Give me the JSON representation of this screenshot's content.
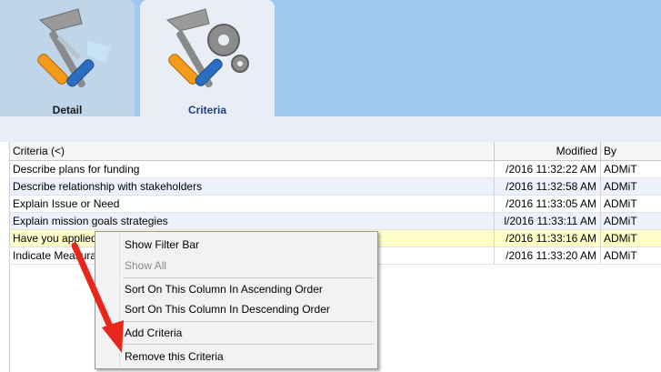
{
  "tabs": [
    {
      "label": "Detail",
      "icon": "hammer-screwdriver-icon",
      "active": false
    },
    {
      "label": "Criteria",
      "icon": "tools-gears-icon",
      "active": true
    }
  ],
  "grid": {
    "headers": {
      "criteria": "Criteria (<)",
      "modified": "Modified",
      "by": "By"
    },
    "rows": [
      {
        "criteria": "Describe plans for funding",
        "modified": "/2016 11:32:22 AM",
        "by": "ADMiT"
      },
      {
        "criteria": "Describe relationship with stakeholders",
        "modified": "/2016 11:32:58 AM",
        "by": "ADMiT"
      },
      {
        "criteria": "Explain Issue or Need",
        "modified": "/2016 11:33:05 AM",
        "by": "ADMiT"
      },
      {
        "criteria": "Explain mission goals strategies",
        "modified": "l/2016 11:33:11 AM",
        "by": "ADMiT"
      },
      {
        "criteria": "Have you applied previously",
        "modified": "/2016 11:33:16 AM",
        "by": "ADMiT"
      },
      {
        "criteria": "Indicate Measurable",
        "modified": "/2016 11:33:20 AM",
        "by": "ADMiT"
      }
    ]
  },
  "context_menu": {
    "items": [
      {
        "label": "Show Filter Bar",
        "enabled": true
      },
      {
        "label": "Show All",
        "enabled": false
      },
      {
        "label": "Sort On This Column In Ascending Order",
        "enabled": true
      },
      {
        "label": "Sort On This Column In Descending Order",
        "enabled": true
      },
      {
        "label": "Add Criteria",
        "enabled": true
      },
      {
        "label": "Remove this Criteria",
        "enabled": true
      }
    ]
  },
  "colors": {
    "topbar": "#9fc8ee",
    "selected_row": "#fffdc8",
    "alt_row": "#eef0fb",
    "arrow": "#e8261c"
  }
}
